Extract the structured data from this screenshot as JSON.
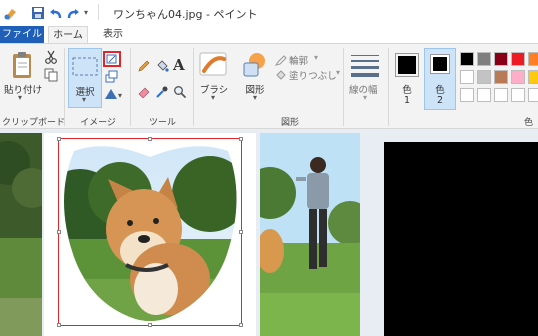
{
  "window": {
    "title": "ワンちゃん04.jpg - ペイント"
  },
  "tabs": {
    "file": "ファイル",
    "home": "ホーム",
    "view": "表示"
  },
  "ribbon": {
    "clipboard": {
      "paste": "貼り付け",
      "group": "クリップボード"
    },
    "image": {
      "select": "選択",
      "group": "イメージ"
    },
    "tools": {
      "group": "ツール"
    },
    "shapes": {
      "brushes": "ブラシ",
      "shapes": "図形",
      "outline": "輪郭",
      "fill": "塗りつぶし",
      "group": "図形"
    },
    "size": {
      "label": "線の幅"
    },
    "colors": {
      "color1": "色",
      "color1_num": "1",
      "color2": "色",
      "color2_num": "2",
      "group": "色",
      "color1_value": "#000000",
      "color2_value": "#000000",
      "palette_row1": [
        "#000000",
        "#7f7f7f",
        "#880015",
        "#ed1c24",
        "#ff7f27"
      ],
      "palette_row2": [
        "#ffffff",
        "#c3c3c3",
        "#b97a57",
        "#ffaec9",
        "#ffc90e"
      ],
      "palette_row3": [
        "#ffffff",
        "#ffffff",
        "#ffffff",
        "#ffffff",
        "#ffffff"
      ]
    }
  }
}
